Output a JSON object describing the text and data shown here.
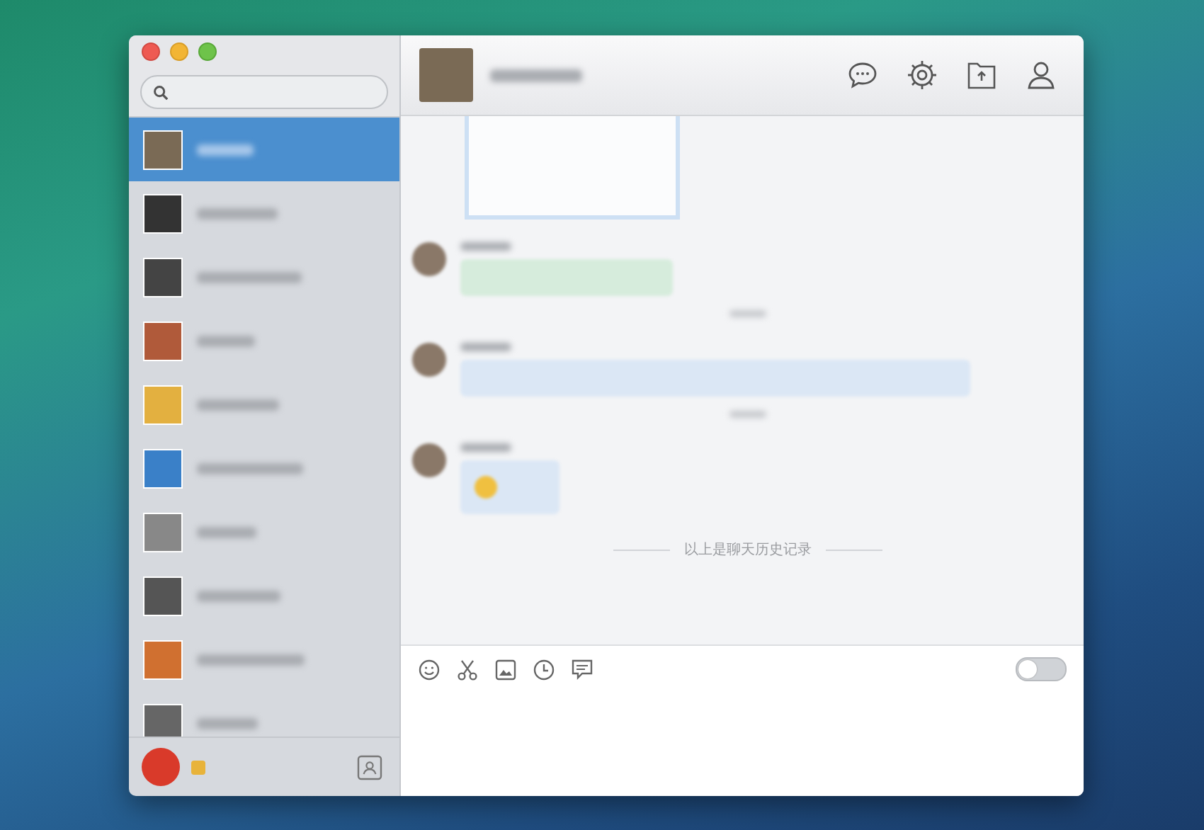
{
  "sidebar": {
    "contacts": [
      {
        "selected": true
      },
      {
        "selected": false
      },
      {
        "selected": false
      },
      {
        "selected": false
      },
      {
        "selected": false
      },
      {
        "selected": false
      },
      {
        "selected": false
      },
      {
        "selected": false
      },
      {
        "selected": false
      },
      {
        "selected": false
      }
    ]
  },
  "chat": {
    "messages": [
      {
        "kind": "card"
      },
      {
        "kind": "short"
      },
      {
        "kind": "time"
      },
      {
        "kind": "long"
      },
      {
        "kind": "time"
      },
      {
        "kind": "emoji"
      }
    ],
    "history_divider": "以上是聊天历史记录"
  },
  "composer": {
    "toggle_on": false
  }
}
